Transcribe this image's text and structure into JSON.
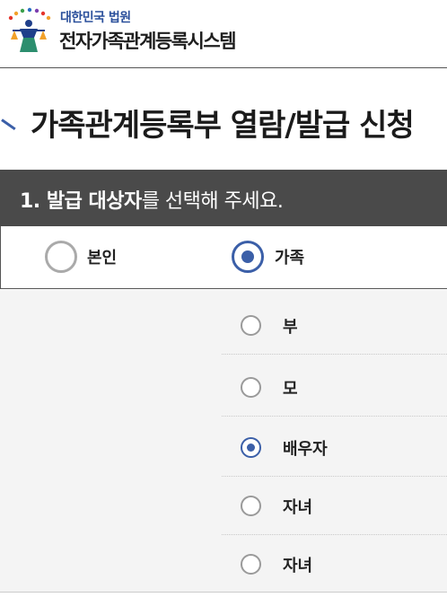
{
  "header": {
    "org_name": "대한민국 법원",
    "system_name": "전자가족관계등록시스템"
  },
  "page": {
    "title": "가족관계등록부 열람/발급 신청"
  },
  "section": {
    "number_label": "1. 발급 대상자",
    "suffix": "를 선택해 주세요."
  },
  "target_options": [
    {
      "label": "본인",
      "checked": false
    },
    {
      "label": "가족",
      "checked": true
    }
  ],
  "family_options": [
    {
      "label": "부",
      "checked": false
    },
    {
      "label": "모",
      "checked": false
    },
    {
      "label": "배우자",
      "checked": true
    },
    {
      "label": "자녀",
      "checked": false
    },
    {
      "label": "자녀",
      "checked": false
    }
  ],
  "colors": {
    "accent": "#3b5fa8",
    "section_bar": "#4a4a4a",
    "panel_bg": "#f4f4f4",
    "org_text": "#2a4f9b"
  }
}
